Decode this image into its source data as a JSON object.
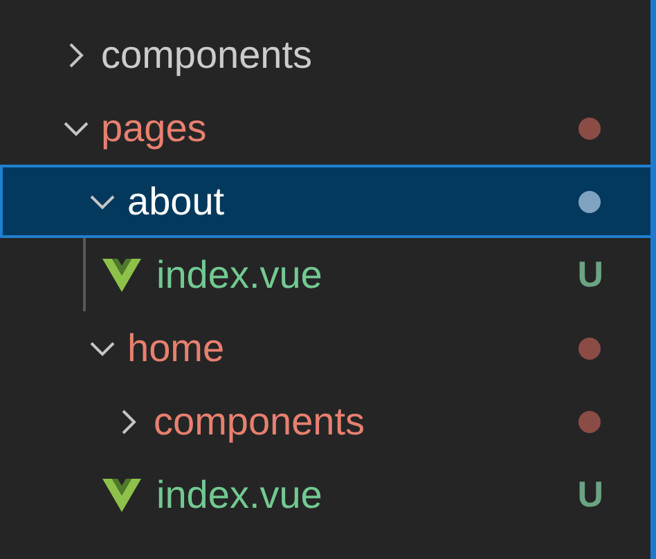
{
  "tree": [
    {
      "kind": "folder",
      "name": "components",
      "expanded": false,
      "selected": false,
      "color": "#cccccc"
    },
    {
      "kind": "folder",
      "name": "pages",
      "expanded": true,
      "selected": false,
      "color": "#e8806f",
      "badge": {
        "kind": "dot",
        "color": "#8c4c46"
      },
      "children": [
        {
          "kind": "folder",
          "name": "about",
          "expanded": true,
          "selected": true,
          "color": "#ffffff",
          "badge": {
            "kind": "dot",
            "color": "#7fa3c0"
          },
          "children": [
            {
              "kind": "file",
              "name": "index.vue",
              "selected": false,
              "color": "#73c991",
              "badge": {
                "kind": "letter",
                "text": "U"
              }
            }
          ]
        },
        {
          "kind": "folder",
          "name": "home",
          "expanded": true,
          "selected": false,
          "color": "#e8806f",
          "badge": {
            "kind": "dot",
            "color": "#8c4c46"
          },
          "children": [
            {
              "kind": "folder",
              "name": "components",
              "expanded": false,
              "selected": false,
              "color": "#e8806f",
              "badge": {
                "kind": "dot",
                "color": "#8c4c46"
              }
            },
            {
              "kind": "file",
              "name": "index.vue",
              "selected": false,
              "color": "#73c991",
              "badge": {
                "kind": "letter",
                "text": "U"
              }
            }
          ]
        }
      ]
    }
  ]
}
